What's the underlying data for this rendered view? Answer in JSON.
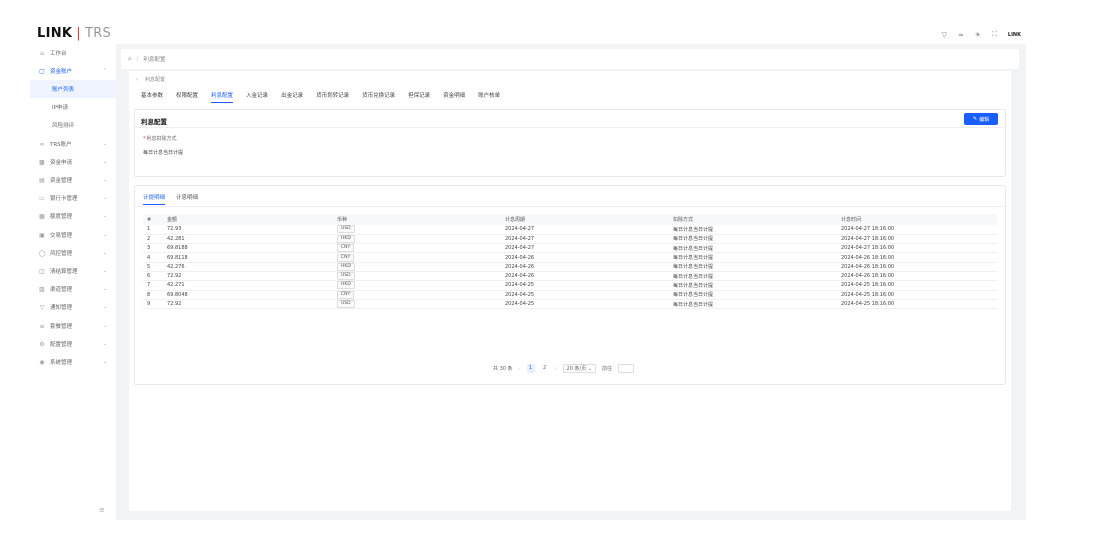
{
  "logo": {
    "brand": "LINK",
    "sep": "|",
    "product": "TRS"
  },
  "top_icons": {
    "user_label": "LINK"
  },
  "sidebar": {
    "items": [
      {
        "label": "工作台",
        "icon": "home-icon"
      },
      {
        "label": "资金账户",
        "icon": "wallet-icon"
      },
      {
        "label": "账户列表",
        "icon": ""
      },
      {
        "label": "IP申请",
        "icon": ""
      },
      {
        "label": "风险测评",
        "icon": ""
      },
      {
        "label": "TRS账户",
        "icon": "link-icon"
      },
      {
        "label": "资金申请",
        "icon": "apply-icon"
      },
      {
        "label": "资金管理",
        "icon": "fund-icon"
      },
      {
        "label": "银行卡管理",
        "icon": "card-icon"
      },
      {
        "label": "额度管理",
        "icon": "quota-icon"
      },
      {
        "label": "交易管理",
        "icon": "trade-icon"
      },
      {
        "label": "风控管理",
        "icon": "shield-icon"
      },
      {
        "label": "清结算管理",
        "icon": "settle-icon"
      },
      {
        "label": "渠道管理",
        "icon": "channel-icon"
      },
      {
        "label": "通知管理",
        "icon": "bell-icon"
      },
      {
        "label": "套餐管理",
        "icon": "package-icon"
      },
      {
        "label": "配置管理",
        "icon": "gear-icon"
      },
      {
        "label": "系统管理",
        "icon": "system-icon"
      }
    ]
  },
  "breadcrumb": {
    "current": "利息配置"
  },
  "back": {
    "label": "利息配置"
  },
  "tabs": [
    "基本参数",
    "权限配置",
    "利息配置",
    "入金记录",
    "出金记录",
    "货币划转记录",
    "货币兑换记录",
    "担保记录",
    "资金明细",
    "账户核单"
  ],
  "config_card": {
    "title": "利息配置",
    "edit_label": "编辑",
    "field_label": "利息扣除方式",
    "field_value": "每日计息当日计提"
  },
  "subtabs": [
    "计提明细",
    "计息明细"
  ],
  "table": {
    "headers": [
      "#",
      "金额",
      "币种",
      "计息周期",
      "扣除方式",
      "计息时间"
    ],
    "rows": [
      [
        "1",
        "72.93",
        "USD",
        "2024-04-27",
        "每日计息当日计提",
        "2024-04-27 18:16:00"
      ],
      [
        "2",
        "42.281",
        "HKD",
        "2024-04-27",
        "每日计息当日计提",
        "2024-04-27 18:16:00"
      ],
      [
        "3",
        "69.8188",
        "CNY",
        "2024-04-27",
        "每日计息当日计提",
        "2024-04-27 18:16:00"
      ],
      [
        "4",
        "69.8118",
        "CNY",
        "2024-04-26",
        "每日计息当日计提",
        "2024-04-26 18:16:00"
      ],
      [
        "5",
        "42.276",
        "HKD",
        "2024-04-26",
        "每日计息当日计提",
        "2024-04-26 18:16:00"
      ],
      [
        "6",
        "72.92",
        "USD",
        "2024-04-26",
        "每日计息当日计提",
        "2024-04-26 18:16:00"
      ],
      [
        "7",
        "42.271",
        "HKD",
        "2024-04-25",
        "每日计息当日计提",
        "2024-04-25 18:16:00"
      ],
      [
        "8",
        "69.8048",
        "CNY",
        "2024-04-25",
        "每日计息当日计提",
        "2024-04-25 18:16:00"
      ],
      [
        "9",
        "72.92",
        "USD",
        "2024-04-25",
        "每日计息当日计提",
        "2024-04-25 18:16:00"
      ]
    ]
  },
  "pager": {
    "total": "共 30 条",
    "page1": "1",
    "page2": "2",
    "page_size": "20 条/页",
    "goto": "前往"
  },
  "colors": {
    "accent": "#1a5eff",
    "brand_red": "#e53935"
  }
}
